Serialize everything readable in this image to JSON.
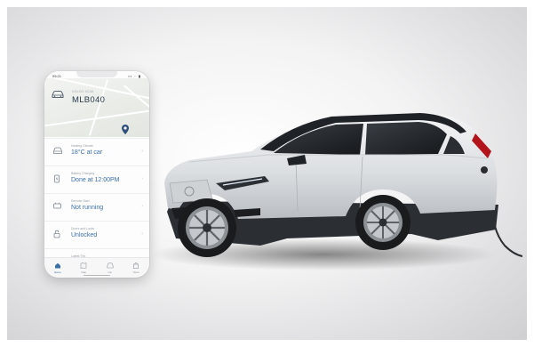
{
  "phone": {
    "status_time": "09:21",
    "status_icons": "▪▪ ◦ ▮",
    "owner_label": "VOLVO XC40",
    "car_name": "MLB040",
    "items": [
      {
        "label": "Heating Climate",
        "value": "18°C at car",
        "icon": "climate-icon"
      },
      {
        "label": "Battery Charging",
        "value": "Done at 12:00PM",
        "icon": "charging-icon"
      },
      {
        "label": "Remote Start",
        "value": "Not running",
        "icon": "engine-icon"
      },
      {
        "label": "Doors and Locks",
        "value": "Unlocked",
        "icon": "lock-icon"
      },
      {
        "label": "Latest Trip",
        "value": "",
        "icon": "trip-icon"
      }
    ],
    "tabs": [
      {
        "label": "Home",
        "icon": "home-icon"
      },
      {
        "label": "Map",
        "icon": "map-icon"
      },
      {
        "label": "Car",
        "icon": "car-icon"
      },
      {
        "label": "Store",
        "icon": "store-icon"
      }
    ],
    "chevron": "›"
  },
  "colors": {
    "accent": "#3b6fa8",
    "car_body": "#e6e8ea",
    "car_roof": "#1d1f22",
    "background": "#e7e7e9"
  }
}
